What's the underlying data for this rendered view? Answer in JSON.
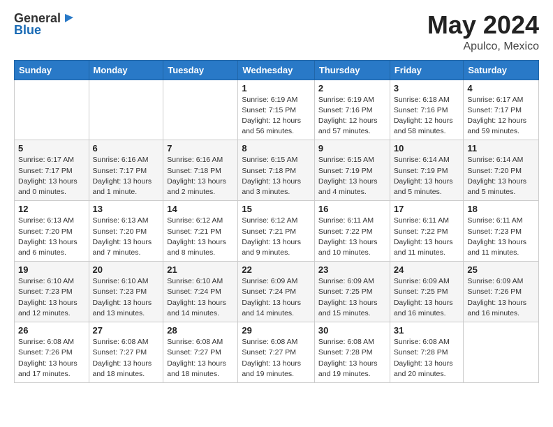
{
  "header": {
    "logo_general": "General",
    "logo_blue": "Blue",
    "title": "May 2024",
    "location": "Apulco, Mexico"
  },
  "days_of_week": [
    "Sunday",
    "Monday",
    "Tuesday",
    "Wednesday",
    "Thursday",
    "Friday",
    "Saturday"
  ],
  "weeks": [
    [
      {
        "day": "",
        "sunrise": "",
        "sunset": "",
        "daylight": ""
      },
      {
        "day": "",
        "sunrise": "",
        "sunset": "",
        "daylight": ""
      },
      {
        "day": "",
        "sunrise": "",
        "sunset": "",
        "daylight": ""
      },
      {
        "day": "1",
        "sunrise": "Sunrise: 6:19 AM",
        "sunset": "Sunset: 7:15 PM",
        "daylight": "Daylight: 12 hours and 56 minutes."
      },
      {
        "day": "2",
        "sunrise": "Sunrise: 6:19 AM",
        "sunset": "Sunset: 7:16 PM",
        "daylight": "Daylight: 12 hours and 57 minutes."
      },
      {
        "day": "3",
        "sunrise": "Sunrise: 6:18 AM",
        "sunset": "Sunset: 7:16 PM",
        "daylight": "Daylight: 12 hours and 58 minutes."
      },
      {
        "day": "4",
        "sunrise": "Sunrise: 6:17 AM",
        "sunset": "Sunset: 7:17 PM",
        "daylight": "Daylight: 12 hours and 59 minutes."
      }
    ],
    [
      {
        "day": "5",
        "sunrise": "Sunrise: 6:17 AM",
        "sunset": "Sunset: 7:17 PM",
        "daylight": "Daylight: 13 hours and 0 minutes."
      },
      {
        "day": "6",
        "sunrise": "Sunrise: 6:16 AM",
        "sunset": "Sunset: 7:17 PM",
        "daylight": "Daylight: 13 hours and 1 minute."
      },
      {
        "day": "7",
        "sunrise": "Sunrise: 6:16 AM",
        "sunset": "Sunset: 7:18 PM",
        "daylight": "Daylight: 13 hours and 2 minutes."
      },
      {
        "day": "8",
        "sunrise": "Sunrise: 6:15 AM",
        "sunset": "Sunset: 7:18 PM",
        "daylight": "Daylight: 13 hours and 3 minutes."
      },
      {
        "day": "9",
        "sunrise": "Sunrise: 6:15 AM",
        "sunset": "Sunset: 7:19 PM",
        "daylight": "Daylight: 13 hours and 4 minutes."
      },
      {
        "day": "10",
        "sunrise": "Sunrise: 6:14 AM",
        "sunset": "Sunset: 7:19 PM",
        "daylight": "Daylight: 13 hours and 5 minutes."
      },
      {
        "day": "11",
        "sunrise": "Sunrise: 6:14 AM",
        "sunset": "Sunset: 7:20 PM",
        "daylight": "Daylight: 13 hours and 5 minutes."
      }
    ],
    [
      {
        "day": "12",
        "sunrise": "Sunrise: 6:13 AM",
        "sunset": "Sunset: 7:20 PM",
        "daylight": "Daylight: 13 hours and 6 minutes."
      },
      {
        "day": "13",
        "sunrise": "Sunrise: 6:13 AM",
        "sunset": "Sunset: 7:20 PM",
        "daylight": "Daylight: 13 hours and 7 minutes."
      },
      {
        "day": "14",
        "sunrise": "Sunrise: 6:12 AM",
        "sunset": "Sunset: 7:21 PM",
        "daylight": "Daylight: 13 hours and 8 minutes."
      },
      {
        "day": "15",
        "sunrise": "Sunrise: 6:12 AM",
        "sunset": "Sunset: 7:21 PM",
        "daylight": "Daylight: 13 hours and 9 minutes."
      },
      {
        "day": "16",
        "sunrise": "Sunrise: 6:11 AM",
        "sunset": "Sunset: 7:22 PM",
        "daylight": "Daylight: 13 hours and 10 minutes."
      },
      {
        "day": "17",
        "sunrise": "Sunrise: 6:11 AM",
        "sunset": "Sunset: 7:22 PM",
        "daylight": "Daylight: 13 hours and 11 minutes."
      },
      {
        "day": "18",
        "sunrise": "Sunrise: 6:11 AM",
        "sunset": "Sunset: 7:23 PM",
        "daylight": "Daylight: 13 hours and 11 minutes."
      }
    ],
    [
      {
        "day": "19",
        "sunrise": "Sunrise: 6:10 AM",
        "sunset": "Sunset: 7:23 PM",
        "daylight": "Daylight: 13 hours and 12 minutes."
      },
      {
        "day": "20",
        "sunrise": "Sunrise: 6:10 AM",
        "sunset": "Sunset: 7:23 PM",
        "daylight": "Daylight: 13 hours and 13 minutes."
      },
      {
        "day": "21",
        "sunrise": "Sunrise: 6:10 AM",
        "sunset": "Sunset: 7:24 PM",
        "daylight": "Daylight: 13 hours and 14 minutes."
      },
      {
        "day": "22",
        "sunrise": "Sunrise: 6:09 AM",
        "sunset": "Sunset: 7:24 PM",
        "daylight": "Daylight: 13 hours and 14 minutes."
      },
      {
        "day": "23",
        "sunrise": "Sunrise: 6:09 AM",
        "sunset": "Sunset: 7:25 PM",
        "daylight": "Daylight: 13 hours and 15 minutes."
      },
      {
        "day": "24",
        "sunrise": "Sunrise: 6:09 AM",
        "sunset": "Sunset: 7:25 PM",
        "daylight": "Daylight: 13 hours and 16 minutes."
      },
      {
        "day": "25",
        "sunrise": "Sunrise: 6:09 AM",
        "sunset": "Sunset: 7:26 PM",
        "daylight": "Daylight: 13 hours and 16 minutes."
      }
    ],
    [
      {
        "day": "26",
        "sunrise": "Sunrise: 6:08 AM",
        "sunset": "Sunset: 7:26 PM",
        "daylight": "Daylight: 13 hours and 17 minutes."
      },
      {
        "day": "27",
        "sunrise": "Sunrise: 6:08 AM",
        "sunset": "Sunset: 7:27 PM",
        "daylight": "Daylight: 13 hours and 18 minutes."
      },
      {
        "day": "28",
        "sunrise": "Sunrise: 6:08 AM",
        "sunset": "Sunset: 7:27 PM",
        "daylight": "Daylight: 13 hours and 18 minutes."
      },
      {
        "day": "29",
        "sunrise": "Sunrise: 6:08 AM",
        "sunset": "Sunset: 7:27 PM",
        "daylight": "Daylight: 13 hours and 19 minutes."
      },
      {
        "day": "30",
        "sunrise": "Sunrise: 6:08 AM",
        "sunset": "Sunset: 7:28 PM",
        "daylight": "Daylight: 13 hours and 19 minutes."
      },
      {
        "day": "31",
        "sunrise": "Sunrise: 6:08 AM",
        "sunset": "Sunset: 7:28 PM",
        "daylight": "Daylight: 13 hours and 20 minutes."
      },
      {
        "day": "",
        "sunrise": "",
        "sunset": "",
        "daylight": ""
      }
    ]
  ]
}
